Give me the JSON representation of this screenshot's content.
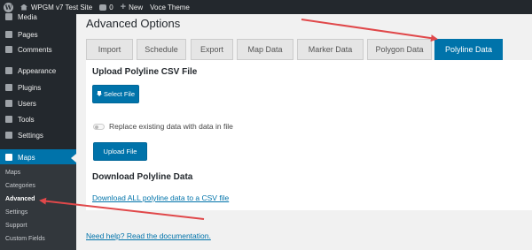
{
  "adminbar": {
    "site_name": "WPGM v7 Test Site",
    "comments_count": "0",
    "new_label": "New",
    "theme_label": "Voce Theme"
  },
  "sidebar": {
    "items": [
      {
        "label": "Media"
      },
      {
        "label": "Pages"
      },
      {
        "label": "Comments"
      },
      {
        "label": "Appearance"
      },
      {
        "label": "Plugins"
      },
      {
        "label": "Users"
      },
      {
        "label": "Tools"
      },
      {
        "label": "Settings"
      },
      {
        "label": "Maps"
      }
    ],
    "submenu": [
      {
        "label": "Maps"
      },
      {
        "label": "Categories"
      },
      {
        "label": "Advanced"
      },
      {
        "label": "Settings"
      },
      {
        "label": "Support"
      },
      {
        "label": "Custom Fields"
      }
    ]
  },
  "page": {
    "title": "Advanced Options",
    "tabs": [
      {
        "label": "Import"
      },
      {
        "label": "Schedule"
      },
      {
        "label": "Export"
      },
      {
        "label": "Map Data"
      },
      {
        "label": "Marker Data"
      },
      {
        "label": "Polygon Data"
      },
      {
        "label": "Polyline Data"
      }
    ],
    "active_tab": "Polyline Data",
    "upload_heading": "Upload Polyline CSV File",
    "select_file_label": "Select File",
    "replace_label": "Replace existing data with data in file",
    "replace_checked": false,
    "upload_button_label": "Upload File",
    "download_heading": "Download Polyline Data",
    "download_link": "Download ALL polyline data to a CSV file",
    "help_link": "Need help? Read the documentation."
  },
  "colors": {
    "accent": "#0073aa",
    "admin_dark": "#23282d",
    "annotation_arrow": "#e0484a"
  }
}
